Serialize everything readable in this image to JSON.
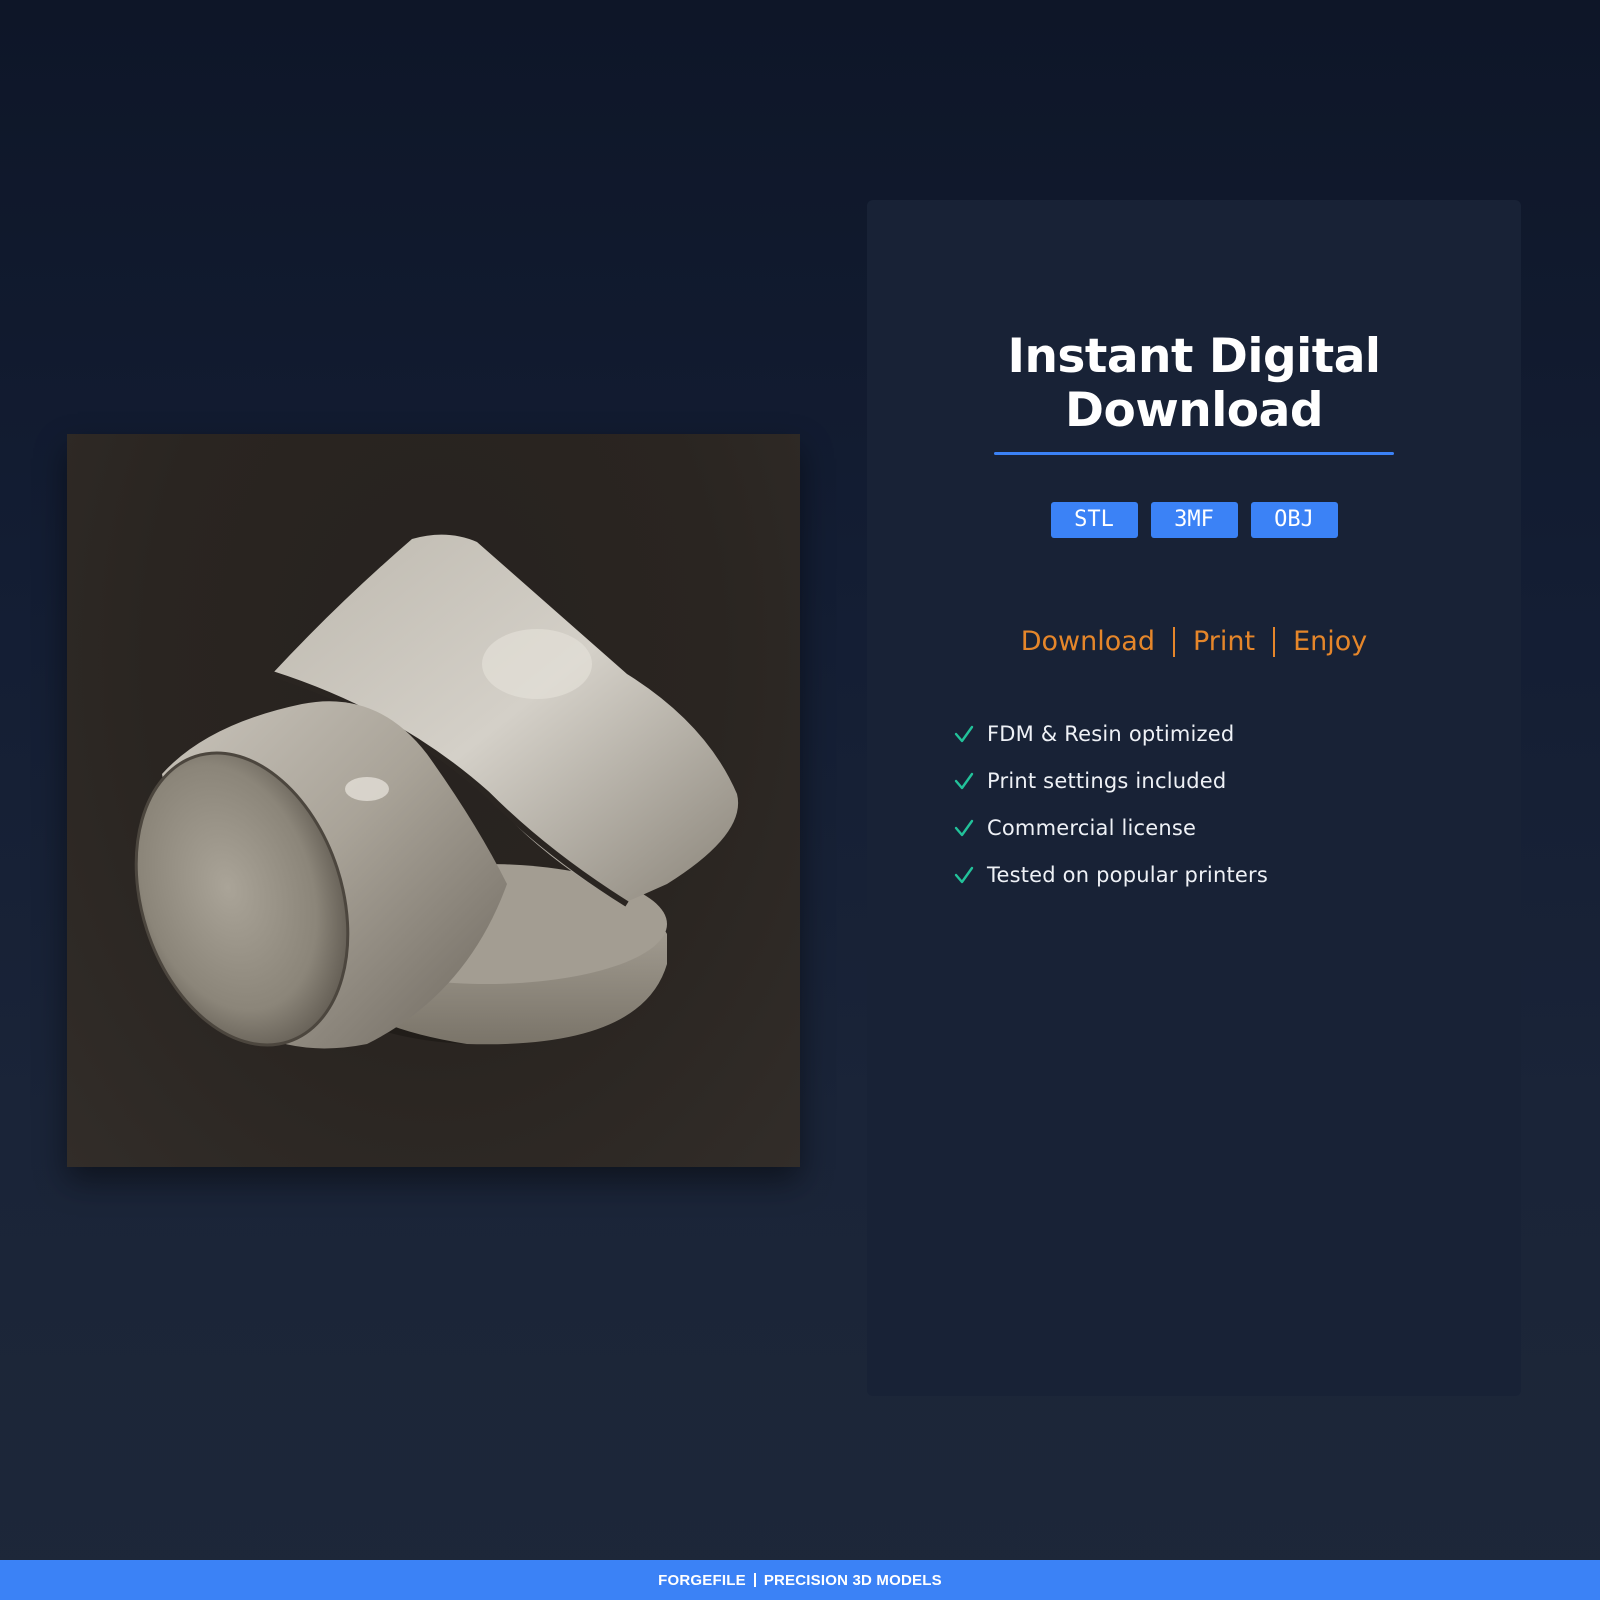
{
  "product": {
    "image_alt": "3D model render"
  },
  "panel": {
    "title_line1": "Instant Digital",
    "title_line2": "Download",
    "formats": [
      "STL",
      "3MF",
      "OBJ"
    ],
    "steps": [
      "Download",
      "Print",
      "Enjoy"
    ],
    "features": [
      "FDM & Resin optimized",
      "Print settings included",
      "Commercial license",
      "Tested on popular printers"
    ]
  },
  "footer": {
    "brand": "FORGEFILE",
    "tagline": "PRECISION 3D MODELS"
  },
  "colors": {
    "accent_blue": "#3b82f6",
    "accent_orange": "#e5862a",
    "check_green": "#22c29a",
    "panel_bg": "#182236"
  },
  "icons": {
    "feature_bullet": "check-icon"
  }
}
